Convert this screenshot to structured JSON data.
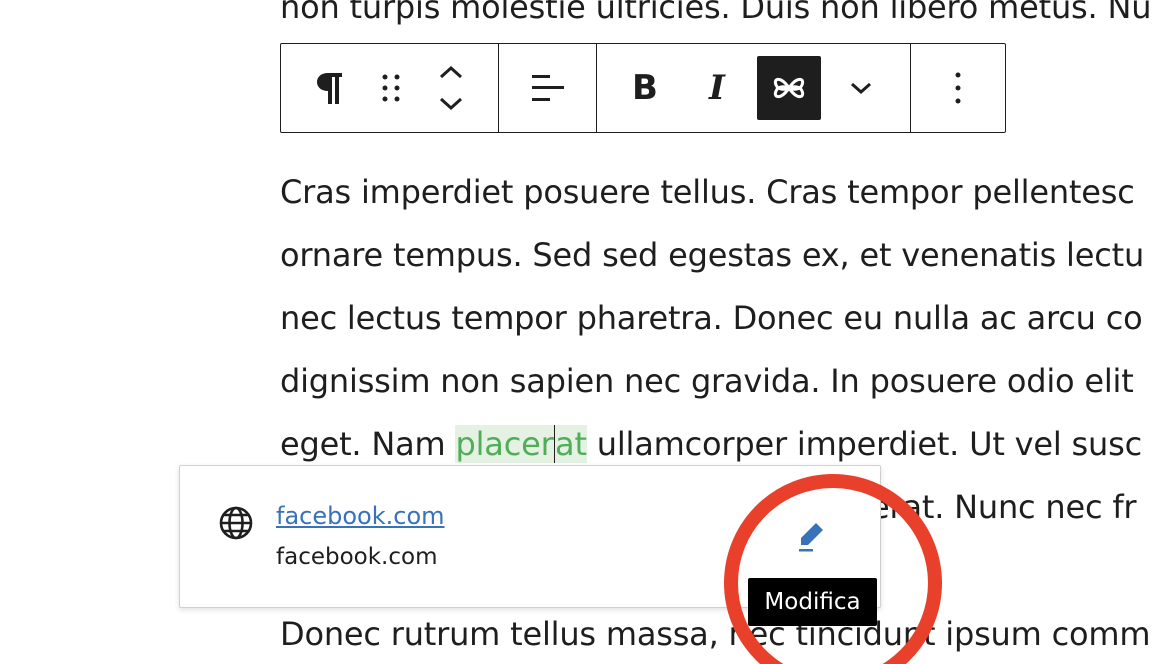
{
  "paragraphs": {
    "top_partial": "non turpis molestie ultricies. Duis non libero metus. Nu",
    "line1": "Cras imperdiet posuere tellus. Cras tempor pellentesc",
    "line2": "ornare tempus. Sed sed egestas ex, et venenatis lectu",
    "line3": "nec lectus tempor pharetra. Donec eu nulla ac arcu co",
    "line4": "dignissim non sapien nec gravida. In posuere odio elit",
    "line5_before": "eget. Nam ",
    "line5_link_a": "placer",
    "line5_link_b": "at",
    "line5_after": " ullamcorper imperdiet. Ut vel susc",
    "line6_tail": "erat. Nunc nec fr",
    "bottom": "Donec rutrum tellus massa, nec tincidunt ipsum comm"
  },
  "toolbar": {
    "paragraph_icon": "paragraph-icon",
    "drag_icon": "drag-handle-icon",
    "move_icon": "move-up-down-icon",
    "align_icon": "align-left-icon",
    "bold_label": "B",
    "italic_label": "I",
    "link_icon": "link-icon",
    "more_icon": "chevron-down-icon",
    "options_icon": "more-vertical-icon"
  },
  "link_popover": {
    "icon": "globe-icon",
    "title": "facebook.com",
    "url": "facebook.com",
    "edit_icon": "pencil-icon"
  },
  "tooltip": {
    "label": "Modifica"
  },
  "colors": {
    "text": "#1e1e1e",
    "link_blue": "#3872b8",
    "highlight_bg": "#e4f1e3",
    "highlight_text": "#4fae57",
    "annotation_red": "#e8402a",
    "edit_blue": "#3872b8"
  }
}
